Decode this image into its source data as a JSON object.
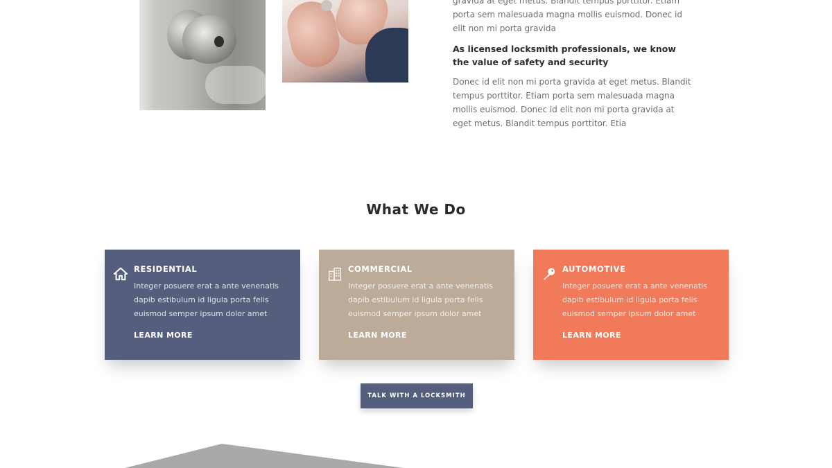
{
  "about": {
    "intro": "gravida at eget metus. Blandit tempus porttitor. Etiam porta sem malesuada magna mollis euismod. Donec id elit non mi porta gravida",
    "subheading": "As licensed locksmith professionals, we know the value of safety and security",
    "body": "Donec id elit non mi porta gravida at eget metus. Blandit tempus porttitor. Etiam porta sem malesuada magna mollis euismod. Donec id elit non mi porta gravida at eget metus. Blandit tempus porttitor. Etia"
  },
  "services": {
    "title": "What We Do",
    "cards": [
      {
        "title": "RESIDENTIAL",
        "icon": "home-icon",
        "color": "#555f7d",
        "text": "Integer posuere erat a ante venenatis dapib estibulum id ligula porta felis euismod semper ipsum dolor amet",
        "link": "LEARN MORE"
      },
      {
        "title": "COMMERCIAL",
        "icon": "building-icon",
        "color": "#bcab99",
        "text": "Integer posuere erat a ante venenatis dapib estibulum id ligula porta felis euismod semper ipsum dolor amet",
        "link": "LEARN MORE"
      },
      {
        "title": "AUTOMOTIVE",
        "icon": "key-icon",
        "color": "#f07a5a",
        "text": "Integer posuere erat a ante venenatis dapib estibulum id ligula porta felis euismod semper ipsum dolor amet",
        "link": "LEARN MORE"
      }
    ],
    "cta_label": "TALK WITH A LOCKSMITH",
    "cta_color": "#555f7d"
  },
  "colors": {
    "heading": "#2a2a2a",
    "body_text": "#6d6d6d",
    "roof": "#a9a9a9"
  }
}
